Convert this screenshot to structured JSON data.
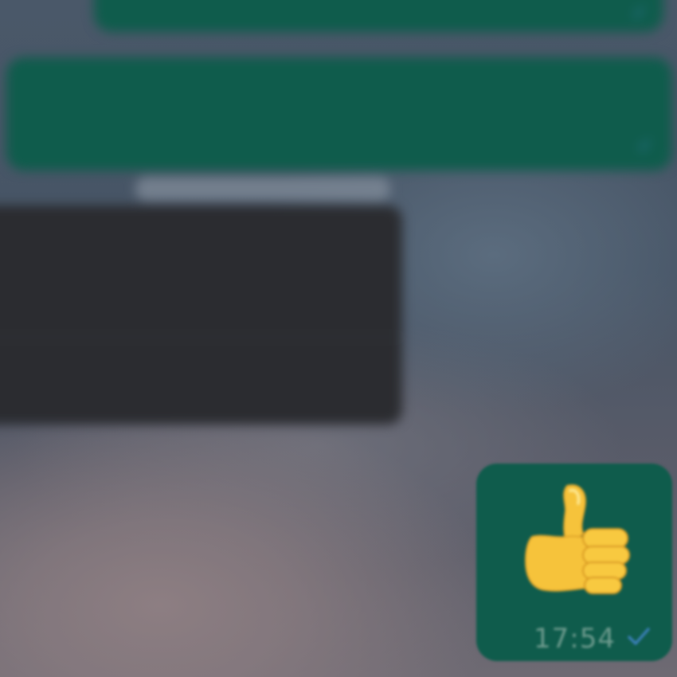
{
  "conversation": {
    "top_message": {
      "text": "",
      "time": "",
      "status_icon": "read-tick-icon"
    },
    "middle_message": {
      "text": "",
      "time": "",
      "status_icon": "read-tick-icon"
    },
    "context_preview": {
      "quote_text": "",
      "reply_text": "",
      "time": ""
    },
    "emoji_message": {
      "emoji": "thumbs-up-icon",
      "time": "17:54",
      "status_icon": "read-tick-icon"
    }
  },
  "colors": {
    "outgoing_bubble": "#0f5c4c",
    "context_panel": "#2b2c30",
    "tick": "#3a7fb7",
    "emoji_yellow": "#f6c33b"
  }
}
